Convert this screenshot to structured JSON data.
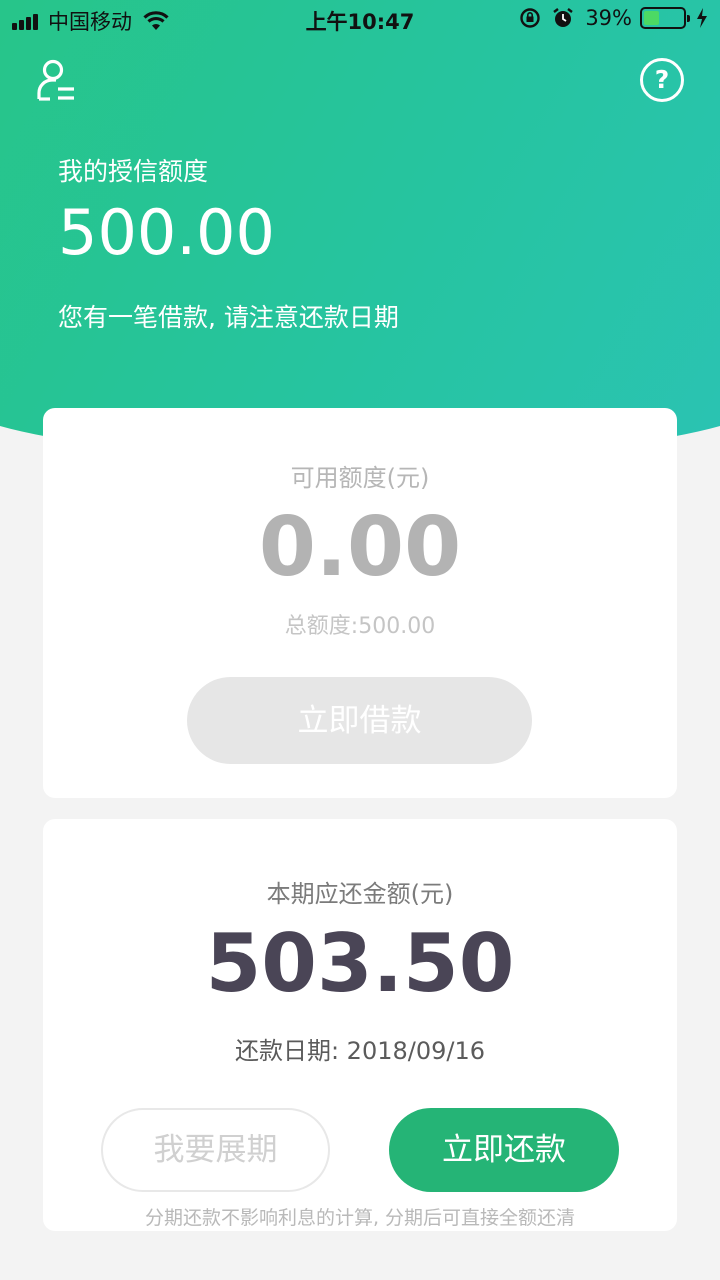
{
  "status_bar": {
    "carrier": "中国移动",
    "time": "上午10:47",
    "battery": "39%",
    "battery_level": 0.39
  },
  "header": {
    "credit_label": "我的授信额度",
    "credit_amount": "500.00",
    "notice": "您有一笔借款, 请注意还款日期"
  },
  "available_card": {
    "label": "可用额度(元)",
    "amount": "0.00",
    "total": "总额度:500.00",
    "borrow_button": "立即借款"
  },
  "repay_card": {
    "label": "本期应还金额(元)",
    "amount": "503.50",
    "due_date": "还款日期: 2018/09/16",
    "extend_button": "我要展期",
    "repay_button": "立即还款",
    "note": "分期还款不影响利息的计算, 分期后可直接全额还清"
  },
  "colors": {
    "brand_green": "#27c587",
    "repay_button": "#25b476",
    "amount_dark": "#4a4556"
  },
  "icons": {
    "profile": "user-icon",
    "help": "help-icon",
    "wifi": "wifi-icon",
    "alarm": "alarm-icon",
    "charging": "charging-icon",
    "orientation_lock": "orientation-lock-icon"
  }
}
